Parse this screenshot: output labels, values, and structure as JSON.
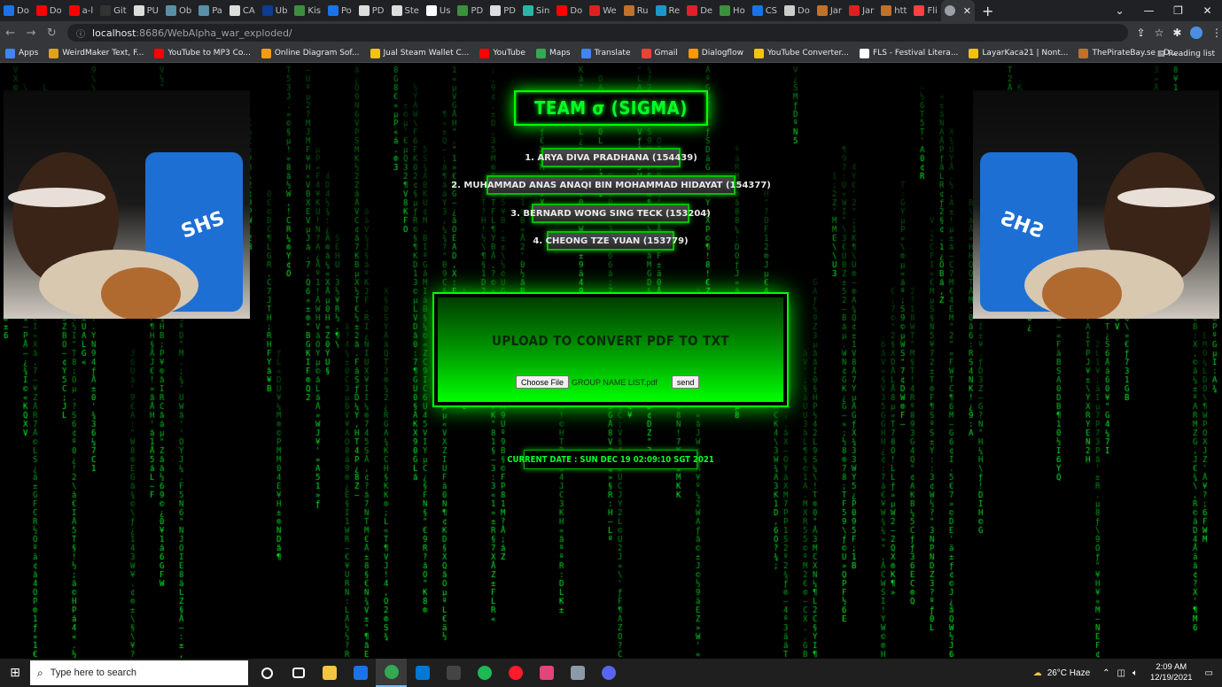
{
  "browser": {
    "tabs": [
      {
        "label": "Do",
        "color": "#1a73e8"
      },
      {
        "label": "Do",
        "color": "#ff0000"
      },
      {
        "label": "a-l",
        "color": "#ff0000"
      },
      {
        "label": "Git",
        "color": "#333333"
      },
      {
        "label": "PU",
        "color": "#dddddd"
      },
      {
        "label": "Ob",
        "color": "#5a8fa8"
      },
      {
        "label": "Pa",
        "color": "#5a8fa8"
      },
      {
        "label": "CA",
        "color": "#dddddd"
      },
      {
        "label": "Ub",
        "color": "#0b3d91"
      },
      {
        "label": "Kis",
        "color": "#3c8f3c"
      },
      {
        "label": "Po",
        "color": "#1a73e8"
      },
      {
        "label": "PD",
        "color": "#dddddd"
      },
      {
        "label": "Ste",
        "color": "#dddddd"
      },
      {
        "label": "Us",
        "color": "#ffffff"
      },
      {
        "label": "PD",
        "color": "#3c8f3c"
      },
      {
        "label": "PD",
        "color": "#dddddd"
      },
      {
        "label": "Sin",
        "color": "#2bb5a5"
      },
      {
        "label": "Do",
        "color": "#ff0000"
      },
      {
        "label": "We",
        "color": "#e02020"
      },
      {
        "label": "Ru",
        "color": "#c0712a"
      },
      {
        "label": "Re",
        "color": "#1a98c8"
      },
      {
        "label": "De",
        "color": "#e0202a"
      },
      {
        "label": "Ho",
        "color": "#3c8f3c"
      },
      {
        "label": "CS",
        "color": "#1a73e8"
      },
      {
        "label": "Do",
        "color": "#cccccc"
      },
      {
        "label": "Jar",
        "color": "#c0712a"
      },
      {
        "label": "Jar",
        "color": "#e02020"
      },
      {
        "label": "htt",
        "color": "#c0712a"
      },
      {
        "label": "Fli",
        "color": "#ff4040"
      }
    ],
    "active_tab": {
      "label": "",
      "close": "✕"
    },
    "new_tab": "+",
    "window_controls": {
      "dropdown": "⌄",
      "minimize": "—",
      "maximize": "❐",
      "close": "✕"
    },
    "url_host": "localhost",
    "url_path": ":8686/WebAlpha_war_exploded/",
    "bookmarks": [
      {
        "label": "Apps",
        "color": "#4285f4"
      },
      {
        "label": "WeirdMaker Text, F...",
        "color": "#e0a020"
      },
      {
        "label": "YouTube to MP3 Co...",
        "color": "#ff0000"
      },
      {
        "label": "Online Diagram Sof...",
        "color": "#f39c12"
      },
      {
        "label": "Jual Steam Wallet C...",
        "color": "#f1c40f"
      },
      {
        "label": "YouTube",
        "color": "#ff0000"
      },
      {
        "label": "Maps",
        "color": "#34a853"
      },
      {
        "label": "Translate",
        "color": "#4285f4"
      },
      {
        "label": "Gmail",
        "color": "#ea4335"
      },
      {
        "label": "Dialogflow",
        "color": "#ff9800"
      },
      {
        "label": "YouTube Converter...",
        "color": "#f1c40f"
      },
      {
        "label": "FLS - Festival Litera...",
        "color": "#ffffff"
      },
      {
        "label": "LayarKaca21 | Nont...",
        "color": "#f1c40f"
      },
      {
        "label": "ThePirateBay.se - D...",
        "color": "#c0712a"
      }
    ],
    "reading_list": "Reading list"
  },
  "page": {
    "title": "TEAM σ (SIGMA)",
    "members": [
      "1. ARYA DIVA PRADHANA (154439)",
      "2. MUHAMMAD ANAS ANAQI BIN MOHAMMAD HIDAYAT (154377)",
      "3. BERNARD WONG SING TECK (153204)",
      "4. CHEONG TZE YUAN (153779)"
    ],
    "upload_title": "UPLOAD TO CONVERT PDF TO TXT",
    "choose_file_label": "Choose File",
    "file_name": "GROUP NAME LIST.pdf",
    "send_label": "send",
    "current_date": "CURRENT DATE : SUN DEC 19 02:09:10 SGT 2021",
    "matrix_color": "#00ff2a",
    "meme_text": "SHS"
  },
  "taskbar": {
    "search_placeholder": "Type here to search",
    "weather": "26°C  Haze",
    "time": "2:09 AM",
    "date": "12/19/2021",
    "apps": [
      {
        "name": "cortana",
        "color": "#ffffff"
      },
      {
        "name": "task-view",
        "color": "#ffffff"
      },
      {
        "name": "file-explorer",
        "color": "#f5c542"
      },
      {
        "name": "mail",
        "color": "#1a73e8"
      },
      {
        "name": "chrome",
        "color": "#34a853"
      },
      {
        "name": "outlook",
        "color": "#0078d4"
      },
      {
        "name": "app-dark",
        "color": "#444444"
      },
      {
        "name": "spotify",
        "color": "#1db954"
      },
      {
        "name": "opera",
        "color": "#ff1b2d"
      },
      {
        "name": "intellij",
        "color": "#e0457b"
      },
      {
        "name": "app-gray",
        "color": "#8a9aa8"
      },
      {
        "name": "discord",
        "color": "#5865f2"
      }
    ]
  }
}
